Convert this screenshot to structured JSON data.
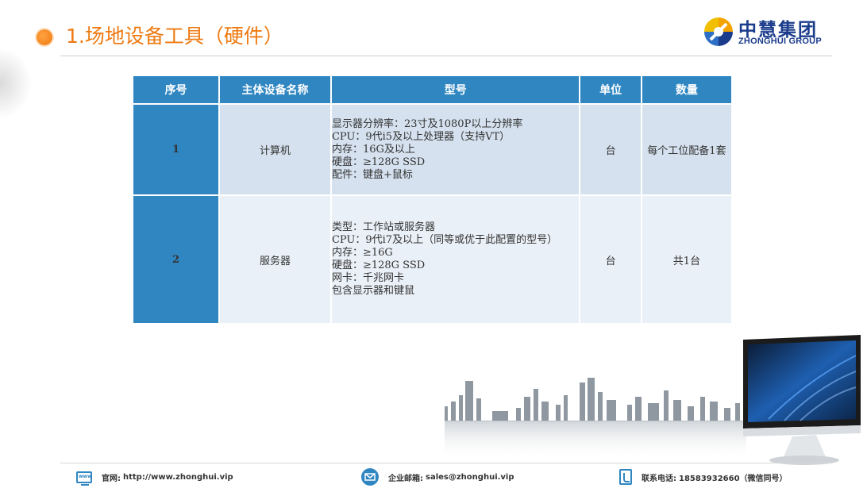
{
  "header": {
    "title": "1.场地设备工具（硬件）",
    "accent_color": "#ee7a12"
  },
  "logo": {
    "name_cn": "中慧集团",
    "name_en": "ZHONGHUI GROUP",
    "brand_color": "#1b3c8c"
  },
  "table": {
    "header_color": "#2f86c1",
    "columns": [
      "序号",
      "主体设备名称",
      "型号",
      "单位",
      "数量"
    ],
    "rows": [
      {
        "no": "1",
        "name": "计算机",
        "model_lines": [
          "显示器分辨率：23寸及1080P以上分辨率",
          "CPU：9代i5及以上处理器（支持VT）",
          "内存：16G及以上",
          "硬盘：≥128G SSD",
          "配件：键盘+鼠标"
        ],
        "unit": "台",
        "qty": "每个工位配备1套"
      },
      {
        "no": "2",
        "name": "服务器",
        "model_lines": [
          "类型：工作站或服务器",
          "CPU：9代i7及以上（同等或优于此配置的型号）",
          "内存：≥16G",
          "硬盘：≥128G SSD",
          "网卡：千兆网卡",
          "包含显示器和键鼠"
        ],
        "unit": "台",
        "qty": "共1台"
      }
    ]
  },
  "footer": {
    "website_icon_text": "www",
    "website_label": "官网:",
    "website_value": "http://www.zhonghui.vip",
    "email_label": "企业邮箱:",
    "email_value": "sales@zhonghui.vip",
    "phone_label": "联系电话:",
    "phone_value": "18583932660（微信同号）"
  }
}
